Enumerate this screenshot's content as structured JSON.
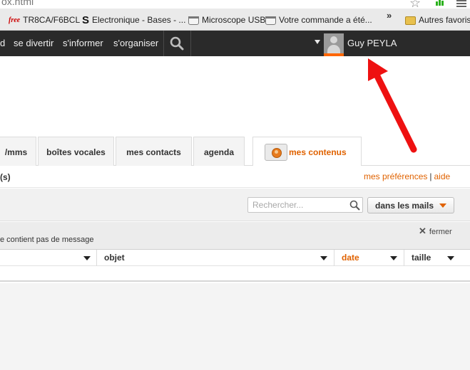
{
  "browser": {
    "url_fragment": "ox.html",
    "bookmarks": [
      {
        "label": "TR8CA/F6BCL",
        "icon": "free-icon"
      },
      {
        "label": "Electronique - Bases - ...",
        "icon": "s-icon"
      },
      {
        "label": "Microscope USB",
        "icon": "cart-icon"
      },
      {
        "label": "Votre commande a été...",
        "icon": "cart-icon"
      }
    ],
    "more_bookmarks": "»",
    "other_bookmarks": "Autres favoris"
  },
  "nav": {
    "items": [
      "d",
      "se divertir",
      "s'informer",
      "s'organiser"
    ],
    "user_name": "Guy PEYLA"
  },
  "tabs": [
    {
      "label": "/mms"
    },
    {
      "label": "boîtes vocales"
    },
    {
      "label": "mes contacts"
    },
    {
      "label": "agenda"
    },
    {
      "label": "mes contenus"
    }
  ],
  "subheader": {
    "count": "(s)",
    "preferences": "mes préférences",
    "separator": "|",
    "help": "aide"
  },
  "toolbar": {
    "search_placeholder": "Rechercher...",
    "scope_label": "dans les mails"
  },
  "info": {
    "message": "e contient pas de message",
    "close_label": "fermer"
  },
  "table": {
    "columns": [
      "",
      "objet",
      "date",
      "taille"
    ]
  },
  "colors": {
    "accent": "#e06200",
    "navbar": "#2a2a2a",
    "annotation": "#ee1111"
  }
}
